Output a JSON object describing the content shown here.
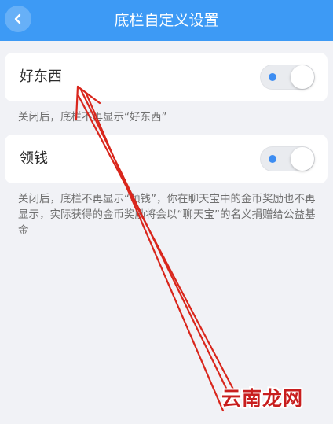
{
  "header": {
    "title": "底栏自定义设置",
    "back_icon": "chevron-left-icon"
  },
  "settings": [
    {
      "label": "好东西",
      "enabled": true,
      "note": "关闭后，底栏不再显示“好东西”"
    },
    {
      "label": "领钱",
      "enabled": true,
      "note": "关闭后，底栏不再显示“领钱”，你在聊天宝中的金币奖励也不再显示，实际获得的金币奖励将会以“聊天宝”的名义捐赠给公益基金"
    }
  ],
  "watermark": "云南龙网",
  "colors": {
    "header_bg": "#3d9af5",
    "page_bg": "#f1f2f6",
    "toggle_dot": "#3d8df2",
    "annotation_arrow": "#d9261c"
  }
}
